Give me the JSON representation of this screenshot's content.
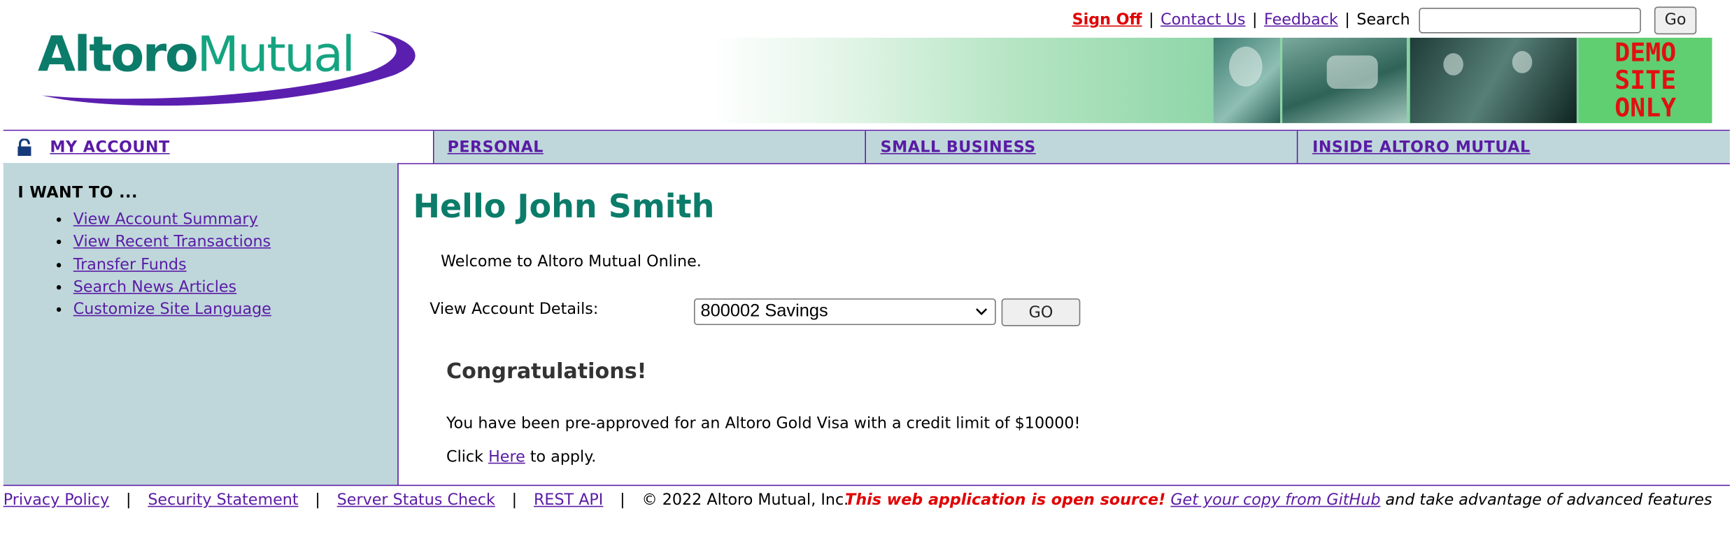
{
  "brand": {
    "logo_part1": "Altoro",
    "logo_part2": "Mutual"
  },
  "top_links": {
    "sign_off": "Sign Off",
    "contact_us": "Contact Us",
    "feedback": "Feedback",
    "search_label": "Search",
    "search_value": "",
    "search_button": "Go",
    "separator": "|"
  },
  "banner": {
    "demo_line1": "DEMO",
    "demo_line2": "SITE",
    "demo_line3": "ONLY"
  },
  "nav": {
    "tabs": [
      {
        "label": "MY ACCOUNT",
        "active": true
      },
      {
        "label": "PERSONAL"
      },
      {
        "label": "SMALL BUSINESS"
      },
      {
        "label": "INSIDE ALTORO MUTUAL"
      }
    ]
  },
  "sidebar": {
    "heading": "I WANT TO ...",
    "items": [
      {
        "label": "View Account Summary"
      },
      {
        "label": "View Recent Transactions"
      },
      {
        "label": "Transfer Funds"
      },
      {
        "label": "Search News Articles"
      },
      {
        "label": "Customize Site Language"
      }
    ]
  },
  "main": {
    "greeting": "Hello John Smith",
    "welcome": "Welcome to Altoro Mutual Online.",
    "account_label": "View Account Details:",
    "account_selected": "800002 Savings",
    "go_button": "GO",
    "congrats_title": "Congratulations!",
    "offer_text": "You have been pre-approved for an Altoro Gold Visa with a credit limit of $10000!",
    "apply_prefix": "Click",
    "apply_link": "Here",
    "apply_suffix": "to apply."
  },
  "footer": {
    "links": [
      {
        "label": "Privacy Policy"
      },
      {
        "label": "Security Statement"
      },
      {
        "label": "Server Status Check"
      },
      {
        "label": "REST API"
      }
    ],
    "separator": "|",
    "copyright": "© 2022 Altoro Mutual, Inc.",
    "open_source": "This web application is open source!",
    "github_link": "Get your copy from GitHub",
    "github_suffix": "and take advantage of advanced features"
  },
  "colors": {
    "accent_purple": "#5a1ba5",
    "brand_teal": "#0c7c6a",
    "panel_bg": "#bfd7db",
    "alert_red": "#e00000"
  }
}
